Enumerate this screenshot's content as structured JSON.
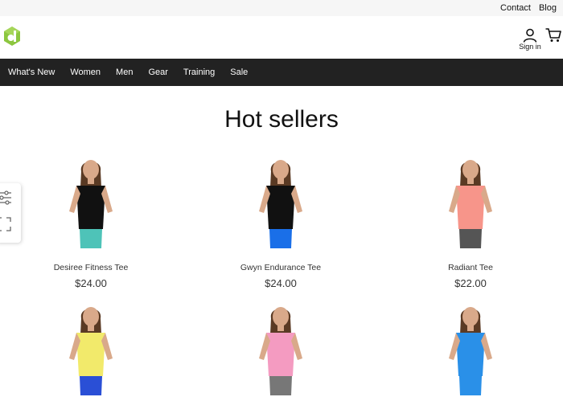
{
  "topbar": {
    "links": [
      "Contact",
      "Blog"
    ]
  },
  "header": {
    "logo_icon": "logo-icon",
    "signin_label": "Sign in",
    "user_icon": "user-icon",
    "cart_icon": "cart-icon",
    "brand_color": "#8cc63f"
  },
  "nav": {
    "items": [
      "What's New",
      "Women",
      "Men",
      "Gear",
      "Training",
      "Sale"
    ]
  },
  "main": {
    "title": "Hot sellers",
    "products": [
      {
        "name": "Desiree Fitness Tee",
        "price": "$24.00",
        "shirt": "#111111",
        "bottom": "#4ec3b8"
      },
      {
        "name": "Gwyn Endurance Tee",
        "price": "$24.00",
        "shirt": "#111111",
        "bottom": "#1a6fe8"
      },
      {
        "name": "Radiant Tee",
        "price": "$22.00",
        "shirt": "#f7958a",
        "bottom": "#555555"
      },
      {
        "name": "",
        "price": "",
        "shirt": "#f2ea6b",
        "bottom": "#2a4fd6"
      },
      {
        "name": "",
        "price": "",
        "shirt": "#f49bc1",
        "bottom": "#777777"
      },
      {
        "name": "",
        "price": "",
        "shirt": "#2a90e8",
        "bottom": "#2a90e8"
      }
    ]
  },
  "side_tools": {
    "icons": [
      "filter-sliders-icon",
      "fullscreen-icon"
    ]
  }
}
